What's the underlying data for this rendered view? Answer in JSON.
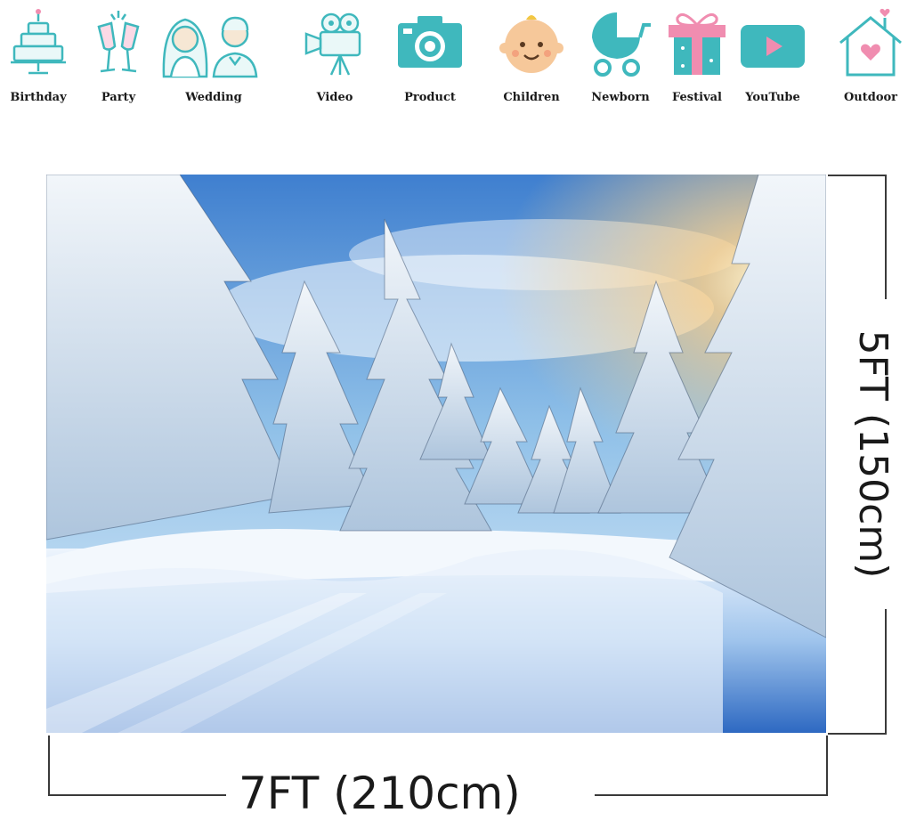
{
  "categories": [
    {
      "label": "Birthday",
      "icon": "cake-icon"
    },
    {
      "label": "Party",
      "icon": "champagne-glasses-icon"
    },
    {
      "label": "Wedding",
      "icon": "bride-groom-icon"
    },
    {
      "label": "Video",
      "icon": "video-camera-icon"
    },
    {
      "label": "Product",
      "icon": "photo-camera-icon"
    },
    {
      "label": "Children",
      "icon": "baby-face-icon"
    },
    {
      "label": "Newborn",
      "icon": "baby-stroller-icon"
    },
    {
      "label": "Festival",
      "icon": "gift-box-icon"
    },
    {
      "label": "YouTube",
      "icon": "play-button-icon"
    },
    {
      "label": "Outdoor",
      "icon": "house-heart-icon"
    }
  ],
  "colors": {
    "teal": "#3fb8bd",
    "pink": "#f08db0",
    "skin": "#f6c89a",
    "gold": "#f2c744",
    "line": "#3a3a3a"
  },
  "dimensions": {
    "width_label": "7FT (210cm)",
    "height_label": "5FT (150cm)"
  },
  "photo": {
    "subject": "snowy-forest-backdrop"
  }
}
